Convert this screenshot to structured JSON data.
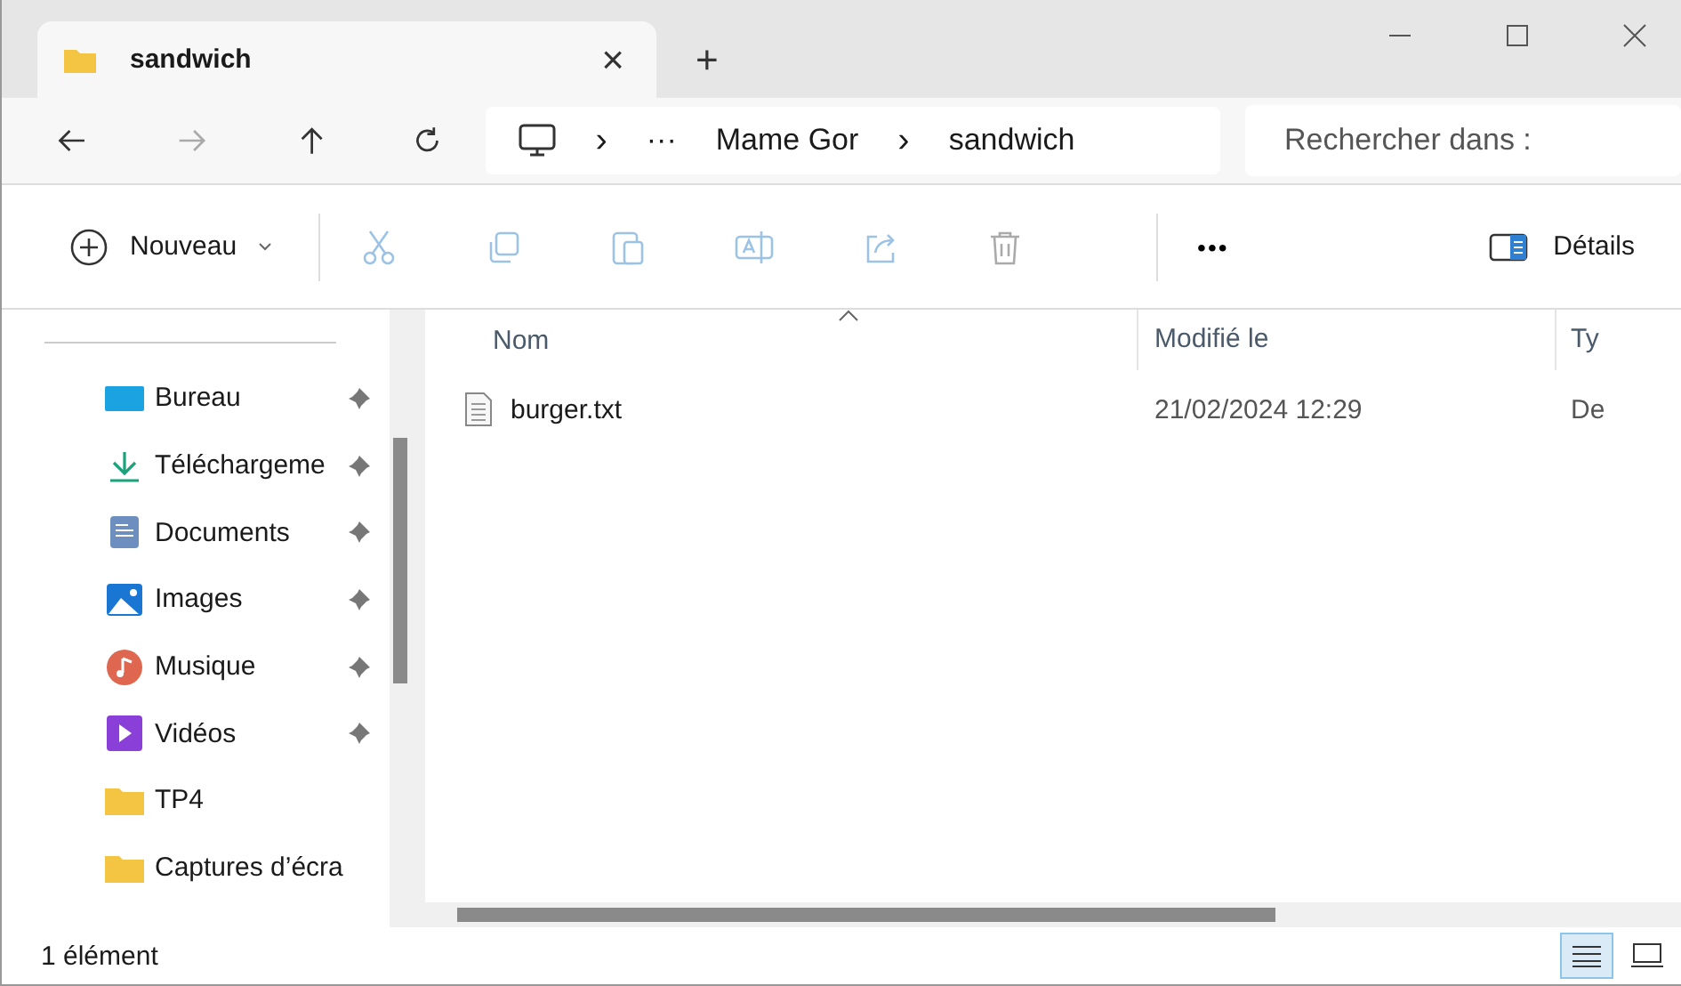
{
  "tabs": [
    {
      "title": "sandwich",
      "selected": true,
      "close": "×"
    }
  ],
  "new_tab": "+",
  "breadcrumb": {
    "overflow": "···",
    "items": [
      "Mame Gor",
      "sandwich"
    ],
    "separator": "›"
  },
  "search": {
    "placeholder": "Rechercher dans :"
  },
  "toolbar": {
    "new_label": "Nouveau",
    "more": "•••",
    "details_label": "Détails"
  },
  "sidebar": {
    "items": [
      {
        "label": "Bureau",
        "kind": "desktop",
        "pinned": true
      },
      {
        "label": "Téléchargeme",
        "kind": "download",
        "pinned": true
      },
      {
        "label": "Documents",
        "kind": "documents",
        "pinned": true
      },
      {
        "label": "Images",
        "kind": "images",
        "pinned": true
      },
      {
        "label": "Musique",
        "kind": "music",
        "pinned": true
      },
      {
        "label": "Vidéos",
        "kind": "videos",
        "pinned": true
      },
      {
        "label": "TP4",
        "kind": "folder",
        "pinned": false
      },
      {
        "label": "Captures d’écra",
        "kind": "folder",
        "pinned": false
      }
    ]
  },
  "table": {
    "columns": [
      "Nom",
      "Modifié le",
      "Ty"
    ],
    "rows": [
      {
        "cells": [
          "burger.txt",
          "21/02/2024 12:29",
          "De"
        ],
        "selected": false
      }
    ]
  },
  "status_bar": {
    "count": "1 élément",
    "views": [
      {
        "kind": "details",
        "selected": true
      },
      {
        "kind": "tiles",
        "selected": false
      }
    ]
  }
}
